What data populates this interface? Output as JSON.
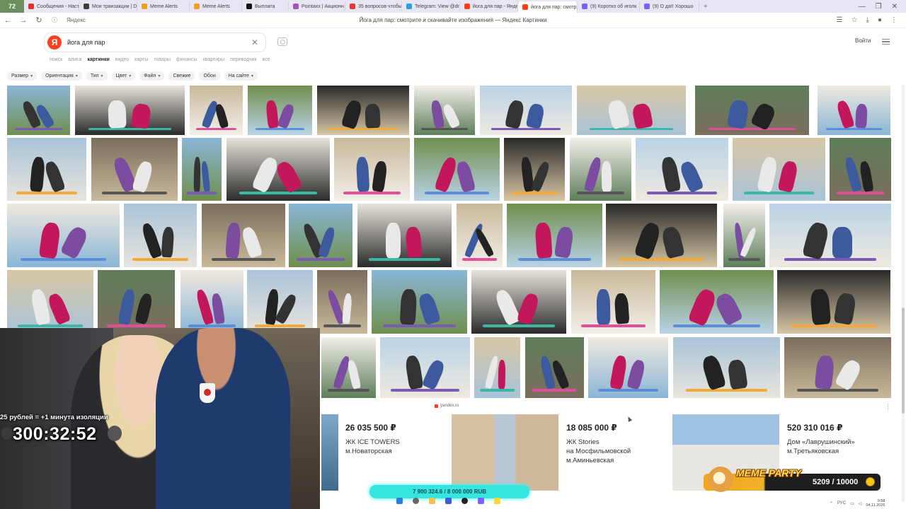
{
  "browser": {
    "tab_badge": "72",
    "tabs": [
      {
        "label": "Сообщения - Настрой",
        "color": "#e1322d"
      },
      {
        "label": "Мои транзакции | Don",
        "color": "#3d3d3d"
      },
      {
        "label": "Meme Alerts",
        "color": "#f0a020"
      },
      {
        "label": "Meme Alerts",
        "color": "#f0a020"
      },
      {
        "label": "Выплата",
        "color": "#111111"
      },
      {
        "label": "Pointaxx | Акционн и",
        "color": "#9b59b6"
      },
      {
        "label": "35 вопросов чтобы к",
        "color": "#e53935"
      },
      {
        "label": "Telegram: View @dmc",
        "color": "#2aa1da"
      },
      {
        "label": "йога для пар - Янде",
        "color": "#fc3f1d"
      },
      {
        "label": "йога для пар: смотр",
        "color": "#fc3f1d",
        "active": true
      },
      {
        "label": "(9) Коротко об иголк",
        "color": "#7b61ff"
      },
      {
        "label": "(9) О да!! Хорошо",
        "color": "#7b61ff"
      }
    ],
    "new_tab": "+",
    "url_host": "Яндекс",
    "page_title": "Йога для пар: смотрите и скачивайте изображения — Яндекс Картинки"
  },
  "yandex": {
    "logo": "Я",
    "search_value": "йога для пар",
    "login": "Войти",
    "service_tabs": [
      "поиск",
      "алиса",
      "картинки",
      "видео",
      "карты",
      "товары",
      "финансы",
      "квартиры",
      "переводчик",
      "все"
    ],
    "active_service": "картинки",
    "filters": [
      "Размер",
      "Ориентация",
      "Тип",
      "Цвет",
      "Файл",
      "Свежие",
      "Обои",
      "На сайте"
    ],
    "source": "yandex.ru"
  },
  "ads": [
    {
      "price": "26 035 500 ₽",
      "name": "ЖК ICE TOWERS",
      "metro": "м.Новаторская"
    },
    {
      "price": "18 085 000 ₽",
      "name": "ЖК Stories",
      "metro": "на Мосфильмовской",
      "metro2": "м.Аминьевская"
    },
    {
      "price": "520 310 016 ₽",
      "name": "Дом «Лаврушинский»",
      "metro": "м.Третьяковская"
    }
  ],
  "stream": {
    "timer_caption": "25 рублей = +1 минута изоляции",
    "timer": "300:32:52",
    "donation": "7 900 324.6 / 8 000 000 RUB",
    "meme_title": "MEME PARTY",
    "meme_count": "5209 / 10000"
  },
  "tray": {
    "lang": "РУС",
    "time": "0:58",
    "date": "04.11.2025"
  }
}
